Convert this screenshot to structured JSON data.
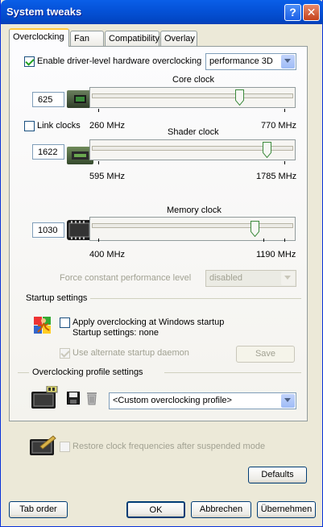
{
  "window": {
    "title": "System tweaks"
  },
  "tabs": [
    {
      "label": "Overclocking",
      "active": true
    },
    {
      "label": "Fan",
      "active": false
    },
    {
      "label": "Compatibility",
      "active": false
    },
    {
      "label": "Overlay",
      "active": false
    }
  ],
  "overclocking": {
    "enable_label": "Enable driver-level hardware overclocking",
    "enable_checked": true,
    "mode_value": "performance 3D",
    "core": {
      "title": "Core clock",
      "value": "625",
      "min_label": "260 MHz",
      "max_label": "770 MHz",
      "min": 260,
      "max": 770,
      "current": 625
    },
    "link_clocks_label": "Link clocks",
    "link_clocks_checked": false,
    "shader": {
      "title": "Shader clock",
      "value": "1622",
      "min_label": "595 MHz",
      "max_label": "1785 MHz",
      "min": 595,
      "max": 1785,
      "current": 1622
    },
    "memory": {
      "title": "Memory clock",
      "value": "1030",
      "min_label": "400 MHz",
      "max_label": "1190 MHz",
      "min": 400,
      "max": 1190,
      "current": 1030
    },
    "force_label": "Force constant performance level",
    "force_value": "disabled"
  },
  "startup": {
    "group_label": "Startup settings",
    "apply_label": "Apply overclocking at Windows startup",
    "apply_checked": false,
    "status": "Startup settings: none",
    "daemon_label": "Use alternate startup daemon",
    "daemon_checked": true,
    "save_label": "Save"
  },
  "profiles": {
    "group_label": "Overclocking profile settings",
    "profile_value": "<Custom overclocking profile>"
  },
  "restore_label": "Restore clock frequencies after suspended mode",
  "restore_checked": false,
  "buttons": {
    "defaults": "Defaults",
    "tab_order": "Tab order",
    "ok": "OK",
    "cancel": "Abbrechen",
    "apply": "Übernehmen"
  },
  "colors": {
    "title_bar": "#0553d9",
    "check": "#21a121",
    "tab_highlight": "#ffc83c"
  }
}
